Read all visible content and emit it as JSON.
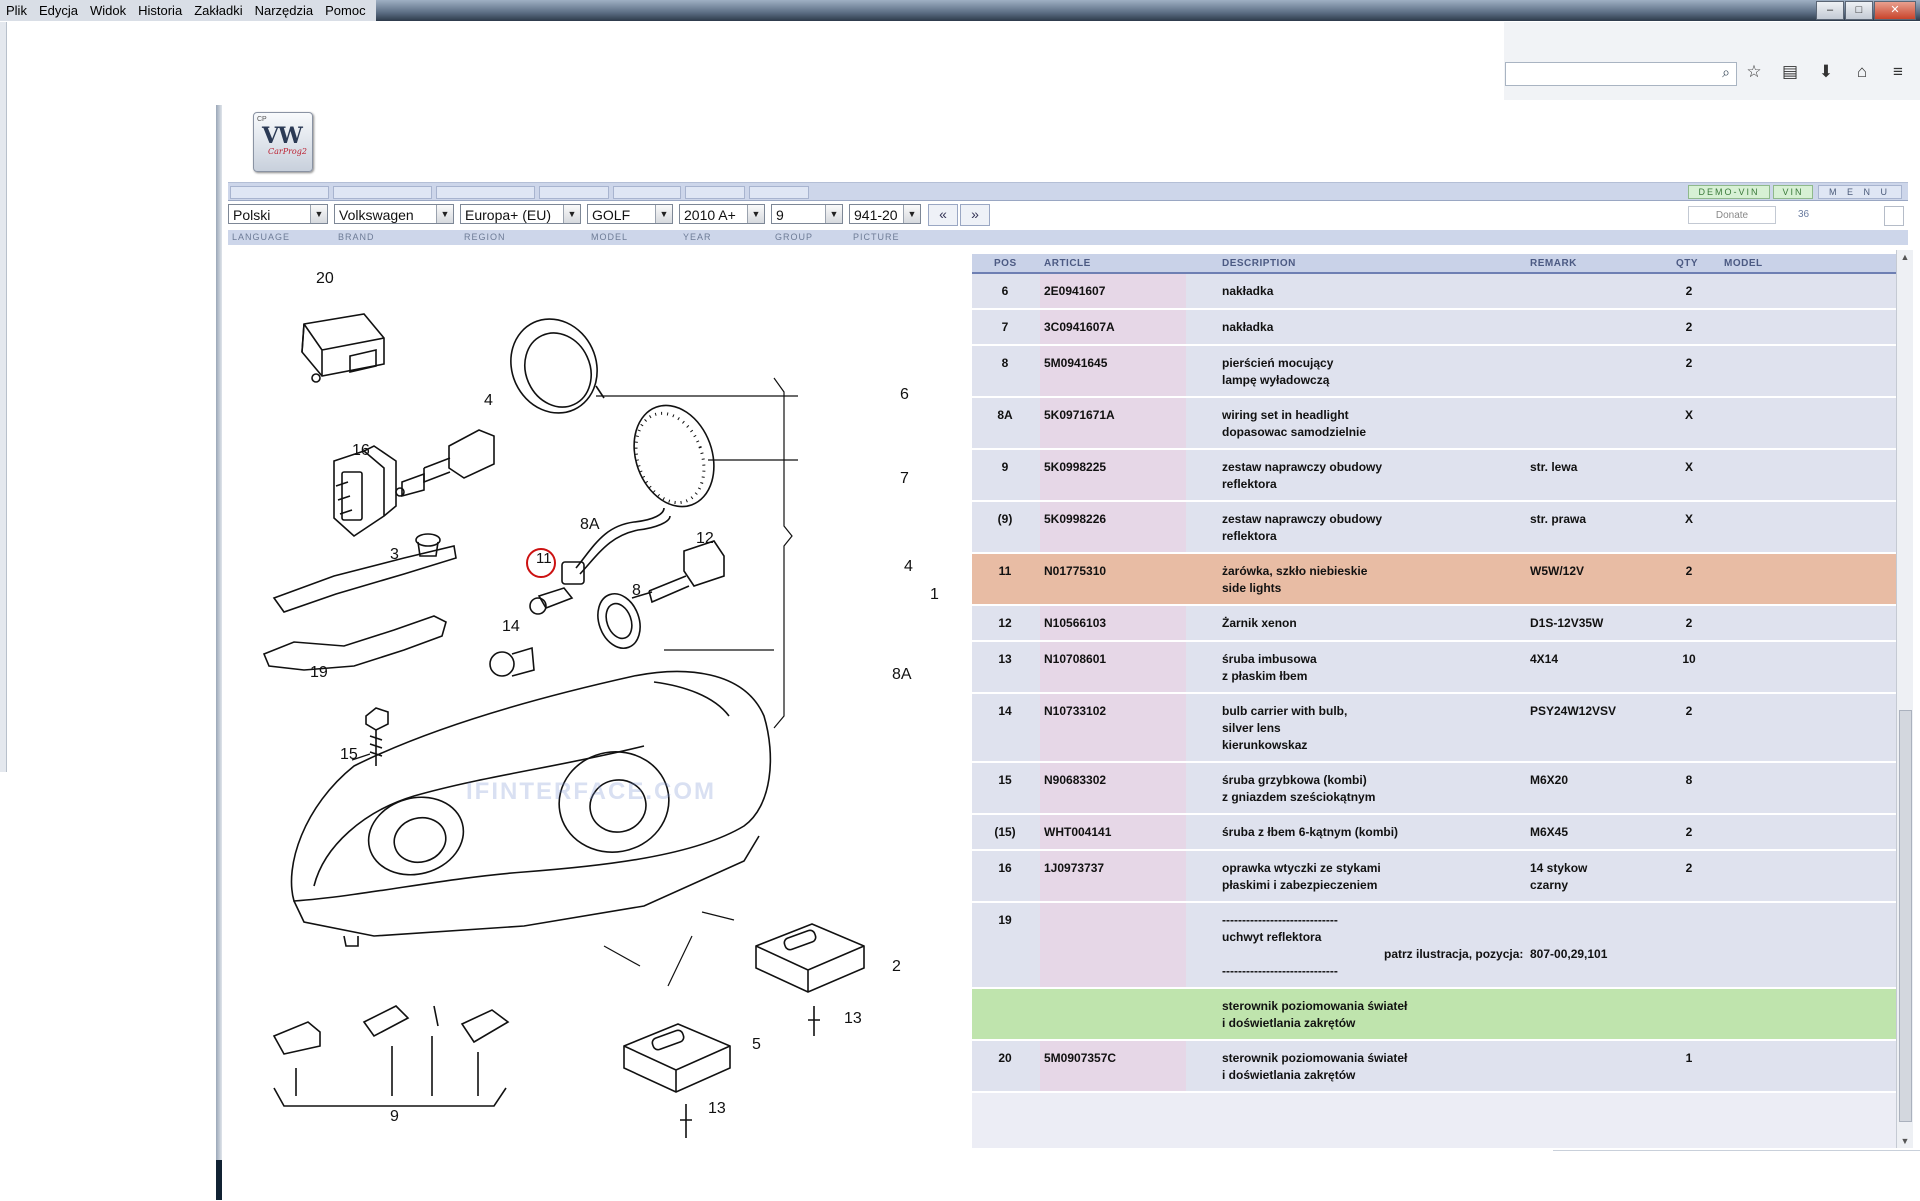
{
  "menubar": {
    "items": [
      "Plik",
      "Edycja",
      "Widok",
      "Historia",
      "Zakładki",
      "Narzędzia",
      "Pomoc"
    ]
  },
  "app": {
    "logo_text": "VW",
    "logo_sub": "CarProg2",
    "logo_corner": "CP"
  },
  "topbar": {
    "demo_vin": "DEMO-VIN",
    "vin": "VIN",
    "menu": "M E N U"
  },
  "selectors": {
    "language": "Polski",
    "brand": "Volkswagen",
    "region": "Europa+ (EU)",
    "model": "GOLF",
    "year": "2010  A+",
    "group": "9",
    "picture": "941-20",
    "prev": "«",
    "next": "»",
    "donate": "Donate",
    "count": "36"
  },
  "labels": {
    "language": "LANGUAGE",
    "brand": "BRAND",
    "region": "REGION",
    "model": "MODEL",
    "year": "YEAR",
    "group": "GROUP",
    "picture": "PICTURE"
  },
  "diagram": {
    "watermark": "IFINTERFACE.COM",
    "callouts": [
      "20",
      "16",
      "4",
      "6",
      "7",
      "3",
      "8A",
      "11",
      "12",
      "8",
      "4",
      "1",
      "19",
      "14",
      "8A",
      "15",
      "2",
      "13",
      "5",
      "13",
      "9"
    ]
  },
  "table": {
    "headers": {
      "pos": "POS",
      "article": "ARTICLE",
      "description": "DESCRIPTION",
      "remark": "REMARK",
      "qty": "QTY",
      "model": "MODEL"
    },
    "rows": [
      {
        "pos": "6",
        "article": "2E0941607",
        "description": "nakładka",
        "remark": "",
        "qty": "2",
        "style": "normal"
      },
      {
        "pos": "7",
        "article": "3C0941607A",
        "description": "nakładka",
        "remark": "",
        "qty": "2",
        "style": "normal"
      },
      {
        "pos": "8",
        "article": "5M0941645",
        "description": "pierścień mocujący\nlampę wyładowczą",
        "remark": "",
        "qty": "2",
        "style": "normal"
      },
      {
        "pos": "8A",
        "article": "5K0971671A",
        "description": "wiring set in headlight\ndopasowac samodzielnie",
        "remark": "",
        "qty": "X",
        "style": "normal"
      },
      {
        "pos": "9",
        "article": "5K0998225",
        "description": "zestaw naprawczy obudowy\nreflektora",
        "remark": "str. lewa",
        "qty": "X",
        "style": "normal"
      },
      {
        "pos": "(9)",
        "article": "5K0998226",
        "description": "zestaw naprawczy obudowy\nreflektora",
        "remark": "str. prawa",
        "qty": "X",
        "style": "normal"
      },
      {
        "pos": "11",
        "article": "N01775310",
        "description": "żarówka, szkło niebieskie\nside lights",
        "remark": "W5W/12V",
        "qty": "2",
        "style": "highlight"
      },
      {
        "pos": "12",
        "article": "N10566103",
        "description": "Żarnik xenon",
        "remark": "D1S-12V35W",
        "qty": "2",
        "style": "normal"
      },
      {
        "pos": "13",
        "article": "N10708601",
        "description": "śruba imbusowa\nz płaskim łbem",
        "remark": "4X14",
        "qty": "10",
        "style": "normal"
      },
      {
        "pos": "14",
        "article": "N10733102",
        "description": "bulb carrier with bulb,\nsilver lens\nkierunkowskaz",
        "remark": "PSY24W12VSV",
        "qty": "2",
        "style": "normal"
      },
      {
        "pos": "15",
        "article": "N90683302",
        "description": "śruba grzybkowa (kombi)\nz gniazdem sześciokątnym",
        "remark": "M6X20",
        "qty": "8",
        "style": "normal"
      },
      {
        "pos": "(15)",
        "article": "WHT004141",
        "description": "śruba z łbem 6-kątnym (kombi)",
        "remark": "M6X45",
        "qty": "2",
        "style": "normal"
      },
      {
        "pos": "16",
        "article": "1J0973737",
        "description": "oprawka wtyczki ze stykami\npłaskimi i zabezpieczeniem",
        "remark": "14 stykow\nczarny",
        "qty": "2",
        "style": "normal"
      },
      {
        "pos": "19",
        "article": "",
        "description": "-----------------------------\nuchwyt reflektora\n\n-----------------------------",
        "remark": "",
        "qty": "",
        "style": "normal",
        "patrz": "patrz ilustracja, pozycja:",
        "patrz_value": "807-00,29,101"
      },
      {
        "pos": "",
        "article": "",
        "description": "sterownik poziomowania świateł\ni doświetlania zakrętów",
        "remark": "",
        "qty": "",
        "style": "green"
      },
      {
        "pos": "20",
        "article": "5M0907357C",
        "description": "sterownik poziomowania świateł\ni doświetlania zakrętów",
        "remark": "",
        "qty": "1",
        "style": "normal"
      }
    ]
  },
  "scrollbar": {
    "up": "▲",
    "down": "▼"
  }
}
